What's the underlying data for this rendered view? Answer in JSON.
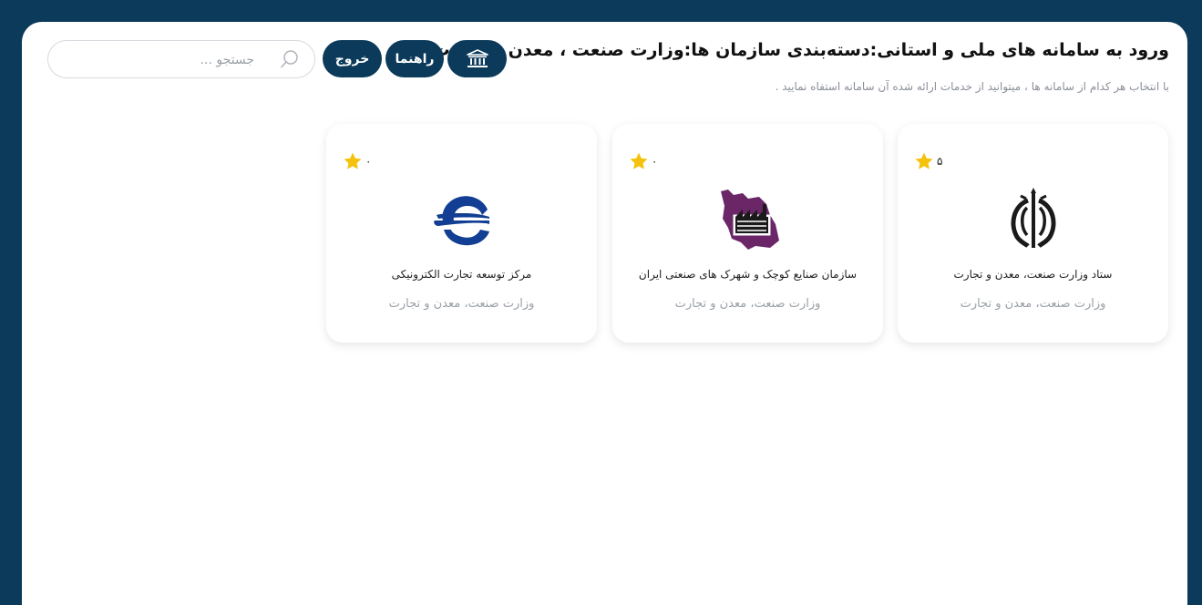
{
  "header": {
    "title": "ورود به سامانه های ملی و استانی:دسته‌بندی سازمان ها:وزارت صنعت ، معدن و تجارت",
    "subtitle": "با انتخاب هر کدام از سامانه ها ، میتوانید از خدمات ارائه شده آن سامانه استفاه نمایید ."
  },
  "toolbar": {
    "home_icon": "bank-building-icon",
    "help_label": "راهنما",
    "exit_label": "خروج"
  },
  "search": {
    "placeholder": "جستجو ...",
    "value": "",
    "icon": "search-icon"
  },
  "colors": {
    "background": "#0b3a5a",
    "button": "#0b3a5a",
    "star": "#f4c20d",
    "muted_text": "#9aa0a6"
  },
  "cards": [
    {
      "name": "ستاد وزارت صنعت، معدن و تجارت",
      "org": "وزارت صنعت، معدن و تجارت",
      "rating": "۵",
      "icon": "iran-emblem-icon"
    },
    {
      "name": "سازمان صنایع کوچک و شهرک های صنعتی ایران",
      "org": "وزارت صنعت، معدن و تجارت",
      "rating": "۰",
      "icon": "iran-map-factory-icon"
    },
    {
      "name": "مرکز توسعه تجارت الکترونیکی",
      "org": "وزارت صنعت، معدن و تجارت",
      "rating": "۰",
      "icon": "ecommerce-e-logo-icon"
    }
  ]
}
